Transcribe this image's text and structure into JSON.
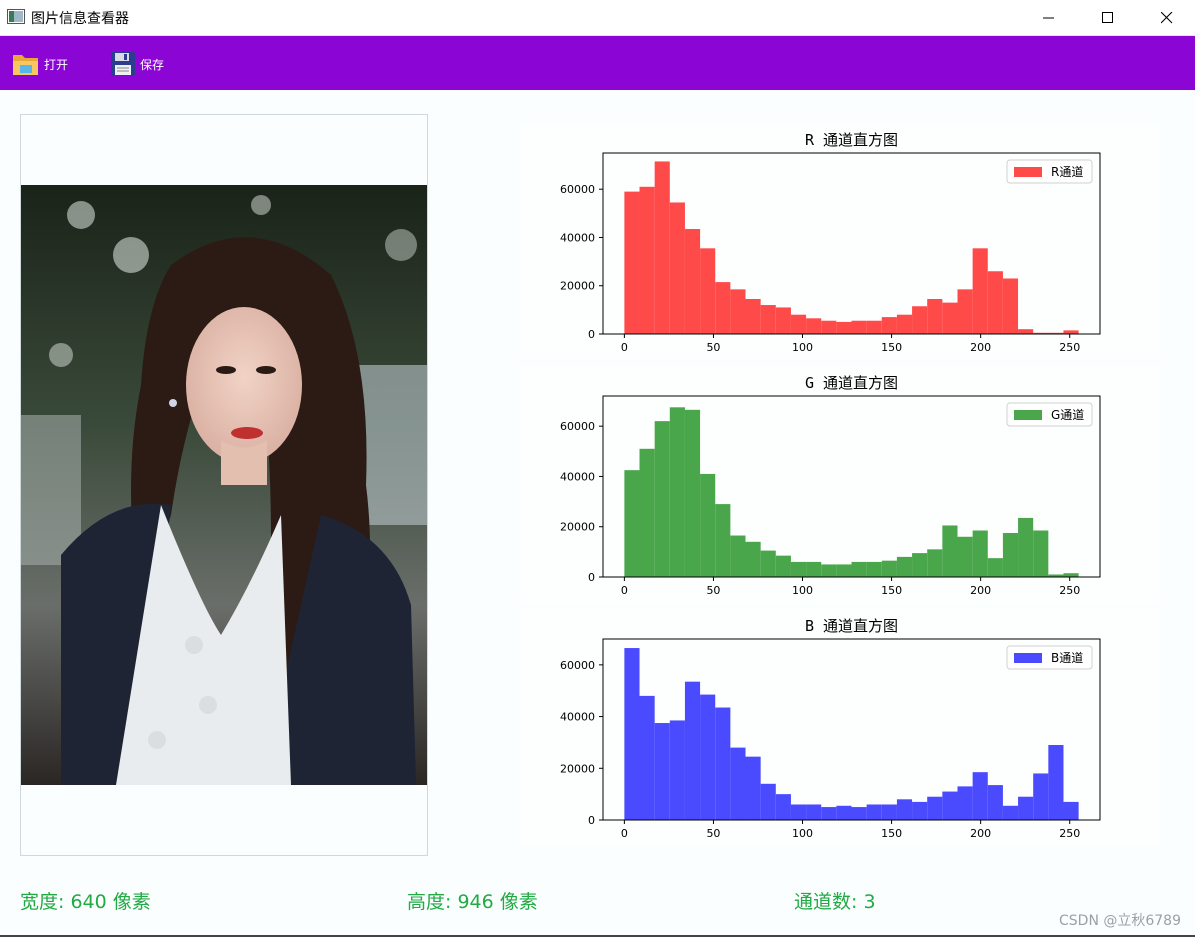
{
  "window": {
    "title": "图片信息查看器"
  },
  "toolbar": {
    "open_label": "打开",
    "save_label": "保存",
    "background": "#8b05d5"
  },
  "info": {
    "width_label": "宽度:",
    "width_value": "640",
    "width_unit": "像素",
    "height_label": "高度:",
    "height_value": "946",
    "height_unit": "像素",
    "channels_label": "通道数:",
    "channels_value": "3",
    "color": "#22aa44"
  },
  "watermark": "CSDN @立秋6789",
  "chart_data": [
    {
      "type": "bar",
      "title": "R 通道直方图",
      "legend": "R通道",
      "legend_position": "top-right",
      "color": "#ff4a4a",
      "bin_width": 8.5,
      "x_start": 0,
      "xlim": [
        -12,
        267
      ],
      "ylim": [
        0,
        75000
      ],
      "xticks": [
        0,
        50,
        100,
        150,
        200,
        250
      ],
      "yticks": [
        0,
        20000,
        40000,
        60000
      ],
      "values": [
        59000,
        61000,
        71500,
        54500,
        43500,
        35500,
        21500,
        18500,
        14500,
        12000,
        11000,
        8000,
        6500,
        5500,
        5000,
        5500,
        5500,
        7000,
        8000,
        11500,
        14500,
        13000,
        18500,
        35500,
        26000,
        23000,
        2000,
        500,
        500,
        1500
      ]
    },
    {
      "type": "bar",
      "title": "G 通道直方图",
      "legend": "G通道",
      "legend_position": "top-right",
      "color": "#4aa64a",
      "bin_width": 8.5,
      "x_start": 0,
      "xlim": [
        -12,
        267
      ],
      "ylim": [
        0,
        72000
      ],
      "xticks": [
        0,
        50,
        100,
        150,
        200,
        250
      ],
      "yticks": [
        0,
        20000,
        40000,
        60000
      ],
      "values": [
        42500,
        51000,
        62000,
        67500,
        66500,
        41000,
        29000,
        16500,
        14000,
        10500,
        8500,
        6000,
        6000,
        5000,
        5000,
        6000,
        6000,
        6500,
        8000,
        9500,
        11000,
        20500,
        16000,
        18500,
        7500,
        17500,
        23500,
        18500,
        1000,
        1500
      ]
    },
    {
      "type": "bar",
      "title": "B 通道直方图",
      "legend": "B通道",
      "legend_position": "top-right",
      "color": "#4a4aff",
      "bin_width": 8.5,
      "x_start": 0,
      "xlim": [
        -12,
        267
      ],
      "ylim": [
        0,
        70000
      ],
      "xticks": [
        0,
        50,
        100,
        150,
        200,
        250
      ],
      "yticks": [
        0,
        20000,
        40000,
        60000
      ],
      "values": [
        66500,
        48000,
        37500,
        38500,
        53500,
        48500,
        43500,
        28000,
        24500,
        14000,
        10000,
        6000,
        6000,
        5000,
        5500,
        5000,
        6000,
        6000,
        8000,
        7000,
        9000,
        11000,
        13000,
        18500,
        13500,
        5500,
        9000,
        18000,
        29000,
        7000
      ]
    }
  ]
}
